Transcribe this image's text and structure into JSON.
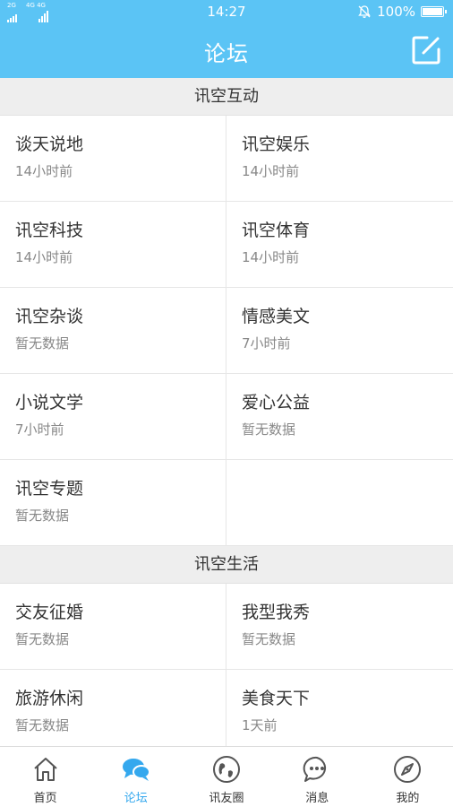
{
  "status_bar": {
    "time": "14:27",
    "battery": "100%",
    "network_tag_1": "2G",
    "network_tag_2": "4G 4G"
  },
  "header": {
    "title": "论坛"
  },
  "sections": [
    {
      "title": "讯空互动",
      "items": [
        {
          "name": "谈天说地",
          "time": "14小时前"
        },
        {
          "name": "讯空娱乐",
          "time": "14小时前"
        },
        {
          "name": "讯空科技",
          "time": "14小时前"
        },
        {
          "name": "讯空体育",
          "time": "14小时前"
        },
        {
          "name": "讯空杂谈",
          "time": "暂无数据"
        },
        {
          "name": "情感美文",
          "time": "7小时前"
        },
        {
          "name": "小说文学",
          "time": "7小时前"
        },
        {
          "name": "爱心公益",
          "time": "暂无数据"
        },
        {
          "name": "讯空专题",
          "time": "暂无数据"
        }
      ]
    },
    {
      "title": "讯空生活",
      "items": [
        {
          "name": "交友征婚",
          "time": "暂无数据"
        },
        {
          "name": "我型我秀",
          "time": "暂无数据"
        },
        {
          "name": "旅游休闲",
          "time": "暂无数据"
        },
        {
          "name": "美食天下",
          "time": "1天前"
        }
      ]
    }
  ],
  "tabs": [
    {
      "label": "首页",
      "icon": "home-icon"
    },
    {
      "label": "论坛",
      "icon": "chat-bubbles-icon",
      "active": true
    },
    {
      "label": "讯友圈",
      "icon": "globe-icon"
    },
    {
      "label": "消息",
      "icon": "message-dots-icon"
    },
    {
      "label": "我的",
      "icon": "compass-icon"
    }
  ],
  "colors": {
    "header_bg": "#5bc4f5",
    "active_tab": "#34a8ee",
    "section_bg": "#eeeeee"
  }
}
